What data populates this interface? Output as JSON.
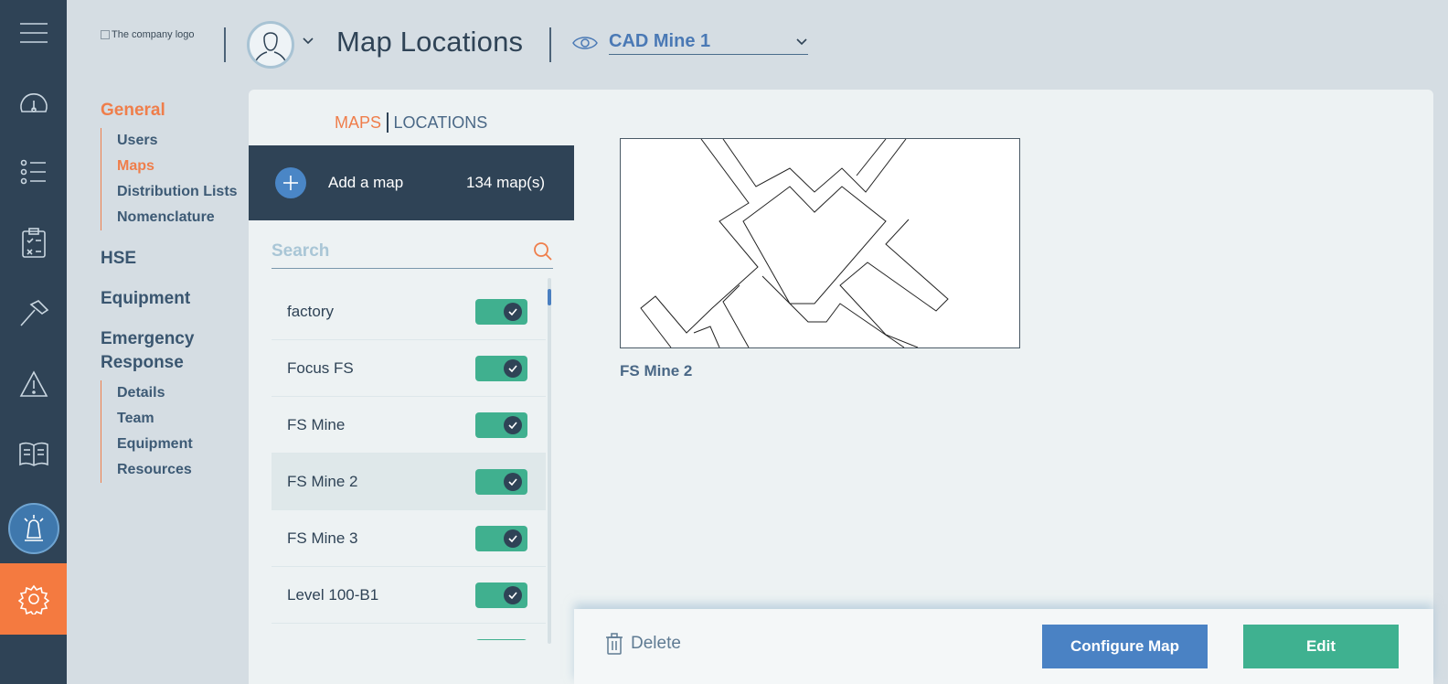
{
  "header": {
    "logo_alt": "The company logo",
    "page_title": "Map Locations",
    "site_selector": {
      "value": "CAD Mine 1"
    }
  },
  "rail": {
    "icons": [
      "menu-icon",
      "dashboard-icon",
      "list-icon",
      "clipboard-icon",
      "hammer-icon",
      "warning-icon",
      "book-icon",
      "alarm-icon",
      "gear-icon"
    ],
    "active": "alarm-icon",
    "highlight_color": "#f47a40"
  },
  "settings_nav": {
    "general": {
      "label": "General",
      "items": [
        "Users",
        "Maps",
        "Distribution Lists",
        "Nomenclature"
      ],
      "active": "Maps"
    },
    "hse": {
      "label": "HSE"
    },
    "equipment": {
      "label": "Equipment"
    },
    "emergency": {
      "label": "Emergency Response",
      "items": [
        "Details",
        "Team",
        "Equipment",
        "Resources"
      ]
    }
  },
  "tabs": {
    "maps": "MAPS",
    "locations": "LOCATIONS",
    "active": "MAPS"
  },
  "add_map": {
    "label": "Add a map",
    "count": "134 map(s)"
  },
  "search": {
    "placeholder": "Search",
    "value": ""
  },
  "map_list": [
    {
      "name": "factory",
      "enabled": true,
      "selected": false
    },
    {
      "name": "Focus FS",
      "enabled": true,
      "selected": false
    },
    {
      "name": "FS Mine",
      "enabled": true,
      "selected": false
    },
    {
      "name": "FS Mine 2",
      "enabled": true,
      "selected": true
    },
    {
      "name": "FS Mine 3",
      "enabled": true,
      "selected": false
    },
    {
      "name": "Level 100-B1",
      "enabled": true,
      "selected": false
    }
  ],
  "preview": {
    "caption": "FS Mine 2"
  },
  "footer": {
    "delete_label": "Delete",
    "configure_label": "Configure Map",
    "edit_label": "Edit"
  },
  "colors": {
    "accent_orange": "#ef7e4b",
    "navy": "#2f4356",
    "blue": "#4a82c4",
    "green": "#3fb190"
  }
}
